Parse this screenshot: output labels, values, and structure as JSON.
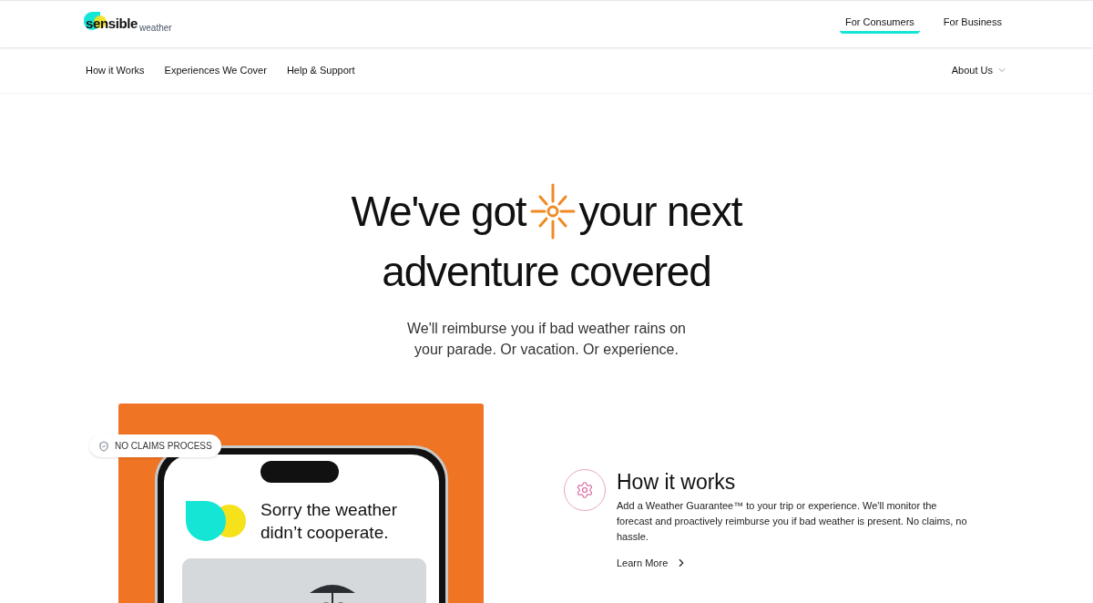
{
  "header": {
    "logo": {
      "main": "sensible",
      "sub": "weather"
    },
    "audience_tabs": [
      {
        "label": "For Consumers",
        "selected": true
      },
      {
        "label": "For Business",
        "selected": false
      }
    ]
  },
  "nav": {
    "items": [
      {
        "label": "How it Works"
      },
      {
        "label": "Experiences We Cover"
      },
      {
        "label": "Help & Support"
      }
    ],
    "menu": {
      "label": "About Us"
    }
  },
  "hero": {
    "headline_before": "We've got",
    "headline_after": "your next",
    "headline_line2": "adventure covered",
    "subtitle": "We'll reimburse you if bad weather rains on your parade. Or vacation. Or experience."
  },
  "promo": {
    "badge": "NO CLAIMS PROCESS",
    "phone_message": "Sorry the weather didn’t cooperate."
  },
  "feature": {
    "title": "How it works",
    "description": "Add a Weather Guarantee™ to your trip or experience. We'll monitor the forecast and proactively reimburse you if bad weather is present. No claims, no hassle.",
    "link": "Learn More"
  }
}
